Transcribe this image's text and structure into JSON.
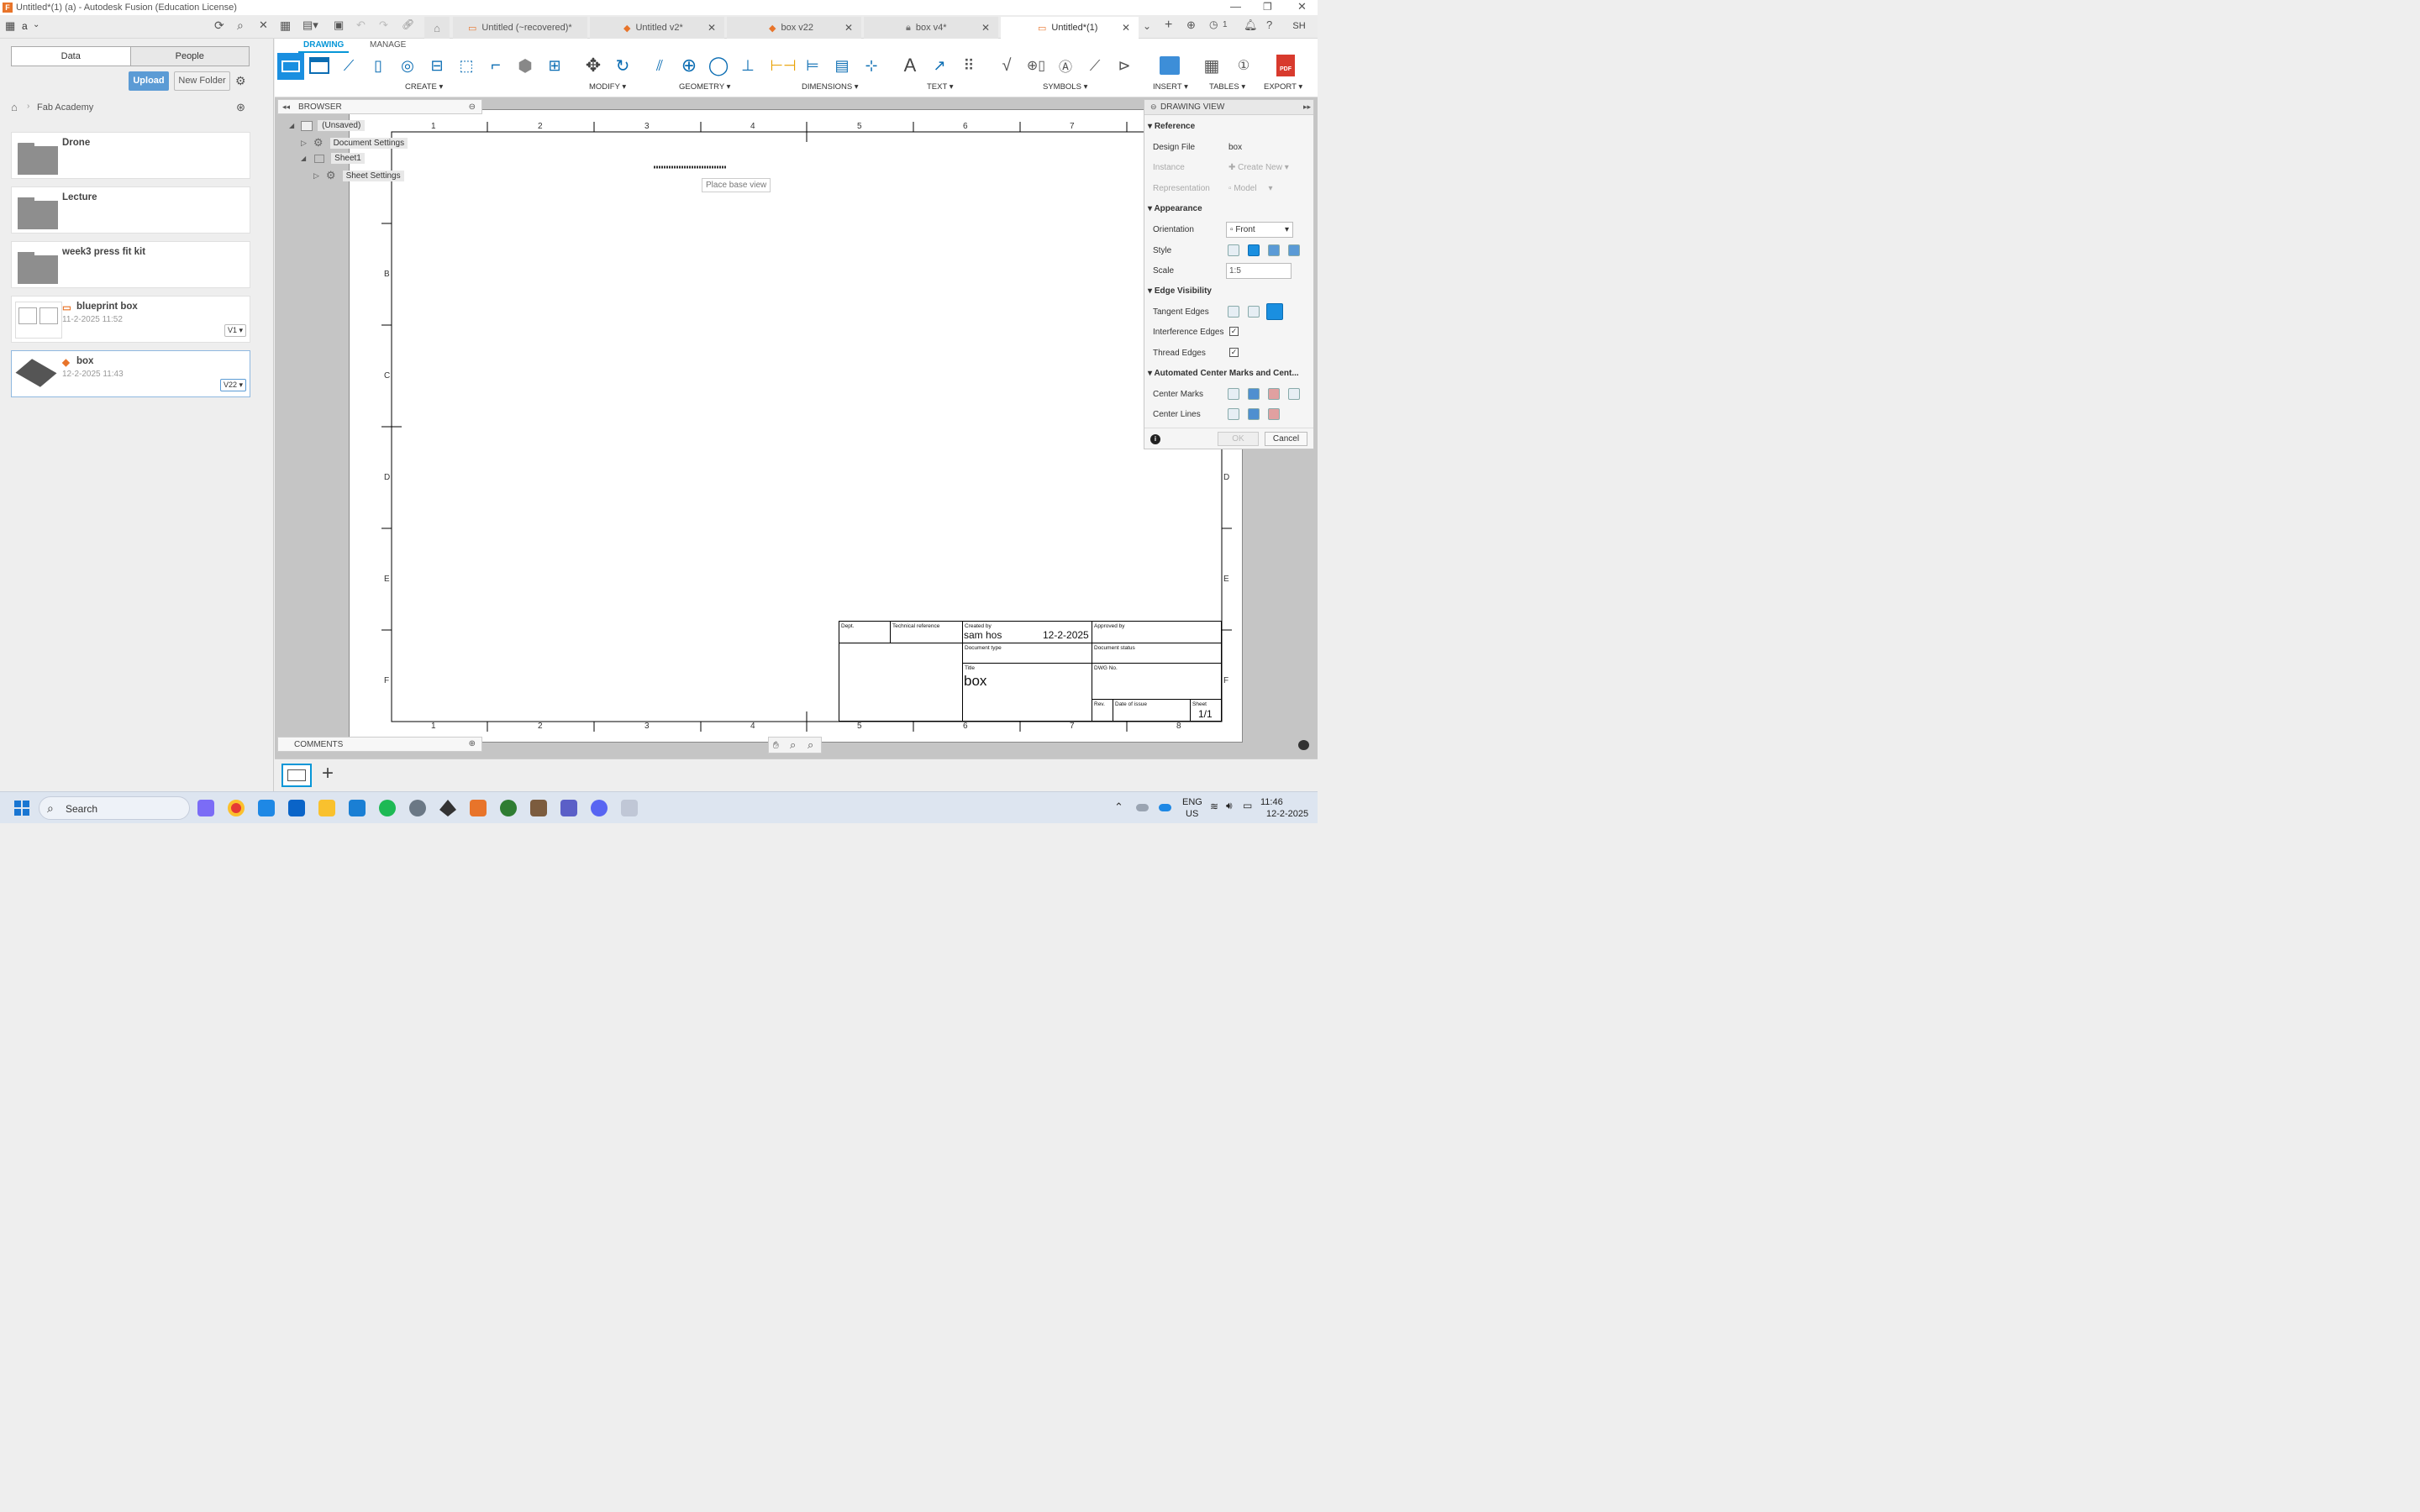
{
  "window": {
    "title": "Untitled*(1) (a) - Autodesk Fusion (Education License)"
  },
  "appbar": {
    "workspace": "a",
    "tabs": [
      {
        "label": "Untitled (~recovered)*"
      },
      {
        "label": "Untitled v2*"
      },
      {
        "label": "box v22"
      },
      {
        "label": "box v4*"
      },
      {
        "label": "Untitled*(1)"
      }
    ],
    "jobs_count": "1",
    "user_initials": "SH"
  },
  "data_panel": {
    "tab_data": "Data",
    "tab_people": "People",
    "upload": "Upload",
    "new_folder": "New Folder",
    "breadcrumb": "Fab Academy",
    "items": [
      {
        "name": "Drone",
        "date": "",
        "version": ""
      },
      {
        "name": "Lecture",
        "date": "",
        "version": ""
      },
      {
        "name": "week3 press fit kit",
        "date": "",
        "version": ""
      },
      {
        "name": "blueprint box",
        "date": "11-2-2025 11:52",
        "version": "V1 ▾"
      },
      {
        "name": "box",
        "date": "12-2-2025 11:43",
        "version": "V22 ▾"
      }
    ]
  },
  "ribbon": {
    "tab_drawing": "DRAWING",
    "tab_manage": "MANAGE",
    "groups": [
      "CREATE ▾",
      "MODIFY ▾",
      "GEOMETRY ▾",
      "DIMENSIONS ▾",
      "TEXT ▾",
      "SYMBOLS ▾",
      "INSERT ▾",
      "TABLES ▾",
      "EXPORT ▾"
    ]
  },
  "browser": {
    "title": "BROWSER",
    "items": [
      "(Unsaved)",
      "Document Settings",
      "Sheet1",
      "Sheet Settings"
    ]
  },
  "canvas": {
    "place_hint": "Place base view",
    "col_numbers": [
      "1",
      "2",
      "3",
      "4",
      "5",
      "6",
      "7",
      "8"
    ],
    "row_letters": [
      "B",
      "C",
      "D",
      "E",
      "F"
    ],
    "title_block": {
      "dept": "Dept.",
      "tech_ref": "Technical reference",
      "created_by_label": "Created by",
      "created_by": "sam hos",
      "created_date": "12-2-2025",
      "approved_by": "Approved by",
      "doc_type": "Document type",
      "doc_status": "Document status",
      "title_label": "Title",
      "title": "box",
      "dwg_no": "DWG No.",
      "rev": "Rev.",
      "date_of_issue": "Date of issue",
      "sheet_label": "Sheet",
      "sheet": "1/1"
    }
  },
  "comments": {
    "title": "COMMENTS"
  },
  "drawing_view": {
    "title": "DRAWING VIEW",
    "sec_reference": "Reference",
    "design_file_label": "Design File",
    "design_file": "box",
    "instance_label": "Instance",
    "instance": "Create New",
    "representation_label": "Representation",
    "representation": "Model",
    "sec_appearance": "Appearance",
    "orientation_label": "Orientation",
    "orientation": "Front",
    "style_label": "Style",
    "scale_label": "Scale",
    "scale": "1:5",
    "sec_edge": "Edge Visibility",
    "tangent_label": "Tangent Edges",
    "interference_label": "Interference Edges",
    "thread_label": "Thread Edges",
    "sec_center": "Automated Center Marks and Cent...",
    "center_marks_label": "Center Marks",
    "center_lines_label": "Center Lines",
    "ok": "OK",
    "cancel": "Cancel"
  },
  "taskbar": {
    "search": "Search",
    "lang": "ENG",
    "region": "US",
    "time": "11:46",
    "date": "12-2-2025"
  },
  "colors": {
    "accent": "#0696d7",
    "upload_btn": "#5b9bd5",
    "sheet_bg": "#ffffff",
    "canvas_bg": "#c5c5c5"
  }
}
